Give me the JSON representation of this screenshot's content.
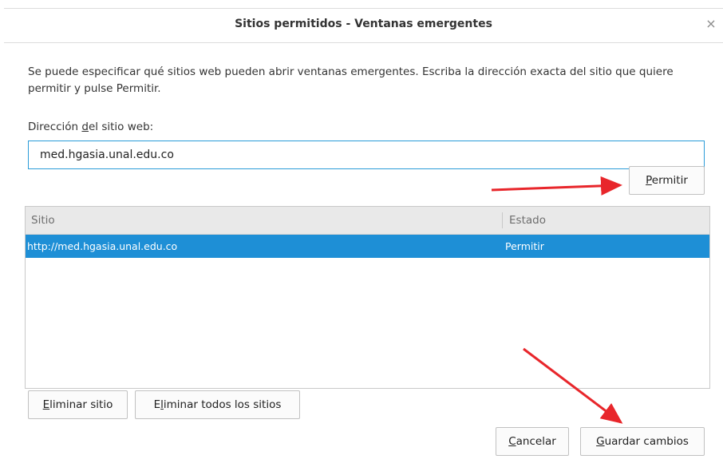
{
  "dialog": {
    "title": "Sitios permitidos - Ventanas emergentes",
    "close_glyph": "×",
    "description": "Se puede especificar qué sitios web pueden abrir ventanas emergentes. Escriba la dirección exacta del sitio que quiere permitir y pulse Permitir.",
    "field_label_pre": "Dirección ",
    "field_label_accel": "d",
    "field_label_post": "el sitio web:",
    "url_value": "med.hgasia.unal.edu.co",
    "allow_button": {
      "accel": "P",
      "rest": "ermitir"
    },
    "table": {
      "columns": [
        "Sitio",
        "Estado"
      ],
      "rows": [
        {
          "site": "http://med.hgasia.unal.edu.co",
          "status": "Permitir",
          "selected": true
        }
      ]
    },
    "remove_button": {
      "accel": "E",
      "rest": "liminar sitio"
    },
    "remove_all_button": {
      "pre": "E",
      "accel": "l",
      "rest": "iminar todos los sitios"
    },
    "cancel_button": {
      "accel": "C",
      "rest": "ancelar"
    },
    "save_button": {
      "accel": "G",
      "rest": "uardar cambios"
    }
  },
  "colors": {
    "accent": "#1e8fd6",
    "focus_border": "#2a9cd8",
    "annotation_arrow": "#e8262b"
  },
  "icons": {
    "close": "close-icon",
    "arrows": "red-annotation-arrow"
  }
}
